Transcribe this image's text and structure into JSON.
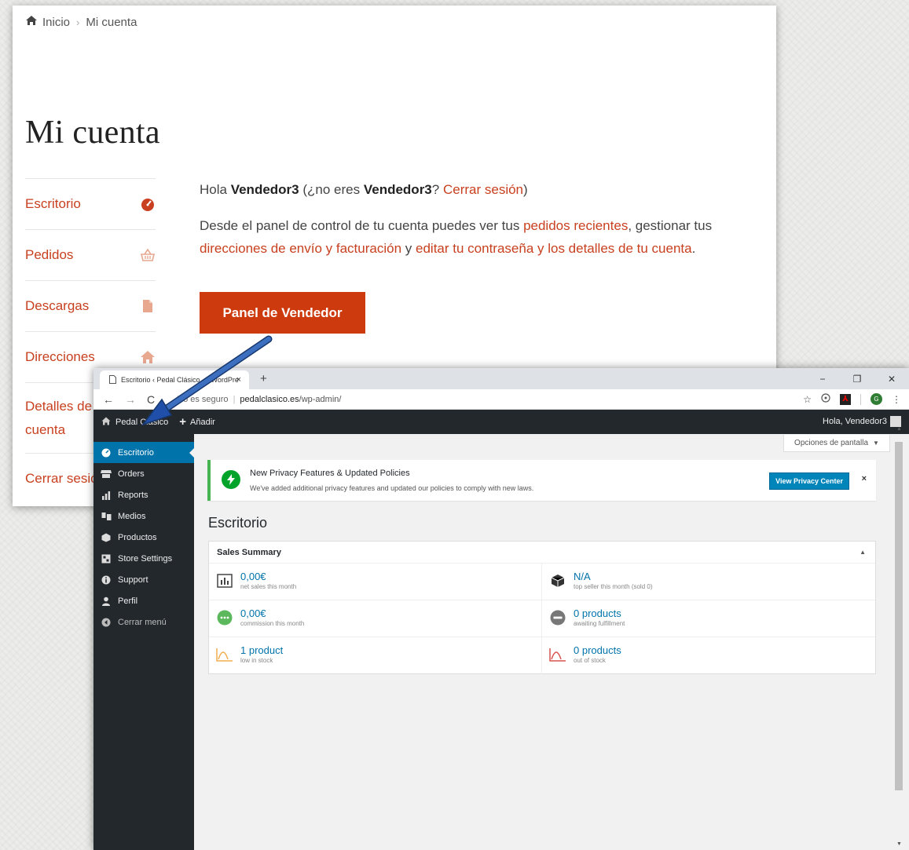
{
  "storefront": {
    "breadcrumb": {
      "home": "Inicio",
      "separator": "›",
      "current": "Mi cuenta"
    },
    "title": "Mi cuenta",
    "nav": [
      {
        "label": "Escritorio",
        "icon": "dashboard-icon"
      },
      {
        "label": "Pedidos",
        "icon": "basket-icon"
      },
      {
        "label": "Descargas",
        "icon": "file-icon"
      },
      {
        "label": "Direcciones",
        "icon": "home-icon"
      },
      {
        "label": "Detalles de la cuenta"
      },
      {
        "label": "Cerrar sesión"
      }
    ],
    "greeting": {
      "hola": "Hola",
      "user": "Vendedor3",
      "no_eres": "(¿no eres",
      "q": "?",
      "logout_link": "Cerrar sesión",
      "close": ")"
    },
    "intro": {
      "t1": "Desde el panel de control de tu cuenta puedes ver tus",
      "l1": "pedidos recientes",
      "t2": ", gestionar tus",
      "l2": "direcciones de envío y facturación",
      "t3": "y",
      "l3": "editar tu contraseña y los detalles de tu cuenta",
      "t4": "."
    },
    "vendor_button": "Panel de Vendedor",
    "accent": "#cc3a0e"
  },
  "browser": {
    "tab_title": "Escritorio ‹ Pedal Clásico — WordPress",
    "tab_close": "×",
    "new_tab": "+",
    "window_controls": {
      "minimize": "−",
      "restore": "❐",
      "close": "✕"
    },
    "nav": {
      "back": "←",
      "forward": "→",
      "reload": "C"
    },
    "url": {
      "insecure": "No es seguro",
      "sep": "|",
      "host": "pedalclasico.es",
      "path": "/wp-admin/"
    },
    "ext": {
      "star": "☆",
      "profile": "G",
      "menu": "⋮",
      "pdf": "⅄"
    }
  },
  "adminbar": {
    "site": "Pedal Clásico",
    "add": "Añadir",
    "greeting": "Hola, Vendedor3"
  },
  "sidebar": [
    {
      "label": "Escritorio",
      "icon": "dashboard-icon",
      "active": true
    },
    {
      "label": "Orders",
      "icon": "store-icon"
    },
    {
      "label": "Reports",
      "icon": "chart-icon"
    },
    {
      "label": "Medios",
      "icon": "media-icon"
    },
    {
      "label": "Productos",
      "icon": "cube-icon"
    },
    {
      "label": "Store Settings",
      "icon": "settings-icon"
    },
    {
      "label": "Support",
      "icon": "info-icon"
    },
    {
      "label": "Perfil",
      "icon": "user-icon"
    },
    {
      "label": "Cerrar menú",
      "icon": "collapse-icon"
    }
  ],
  "screen_options": {
    "label": "Opciones de pantalla",
    "caret": "▼"
  },
  "notice": {
    "title": "New Privacy Features & Updated Policies",
    "desc": "We've added additional privacy features and updated our policies to comply with new laws.",
    "button": "View Privacy Center",
    "dismiss": "×"
  },
  "page_title": "Escritorio",
  "sales_summary": {
    "title": "Sales Summary",
    "toggle": "▲",
    "cells": [
      {
        "value": "0,00€",
        "label": "net sales this month",
        "icon": "bar-chart-icon"
      },
      {
        "value": "N/A",
        "label": "top seller this month (sold 0)",
        "icon": "cube-icon"
      },
      {
        "value": "0,00€",
        "label": "commission this month",
        "icon": "more-icon"
      },
      {
        "value": "0 products",
        "label": "awaiting fulfillment",
        "icon": "minus-circle-icon"
      },
      {
        "value": "1 product",
        "label": "low in stock",
        "icon": "low-stock-icon"
      },
      {
        "value": "0 products",
        "label": "out of stock",
        "icon": "out-of-stock-icon"
      }
    ]
  },
  "scroll": {
    "up": "▲",
    "down": "▼"
  }
}
